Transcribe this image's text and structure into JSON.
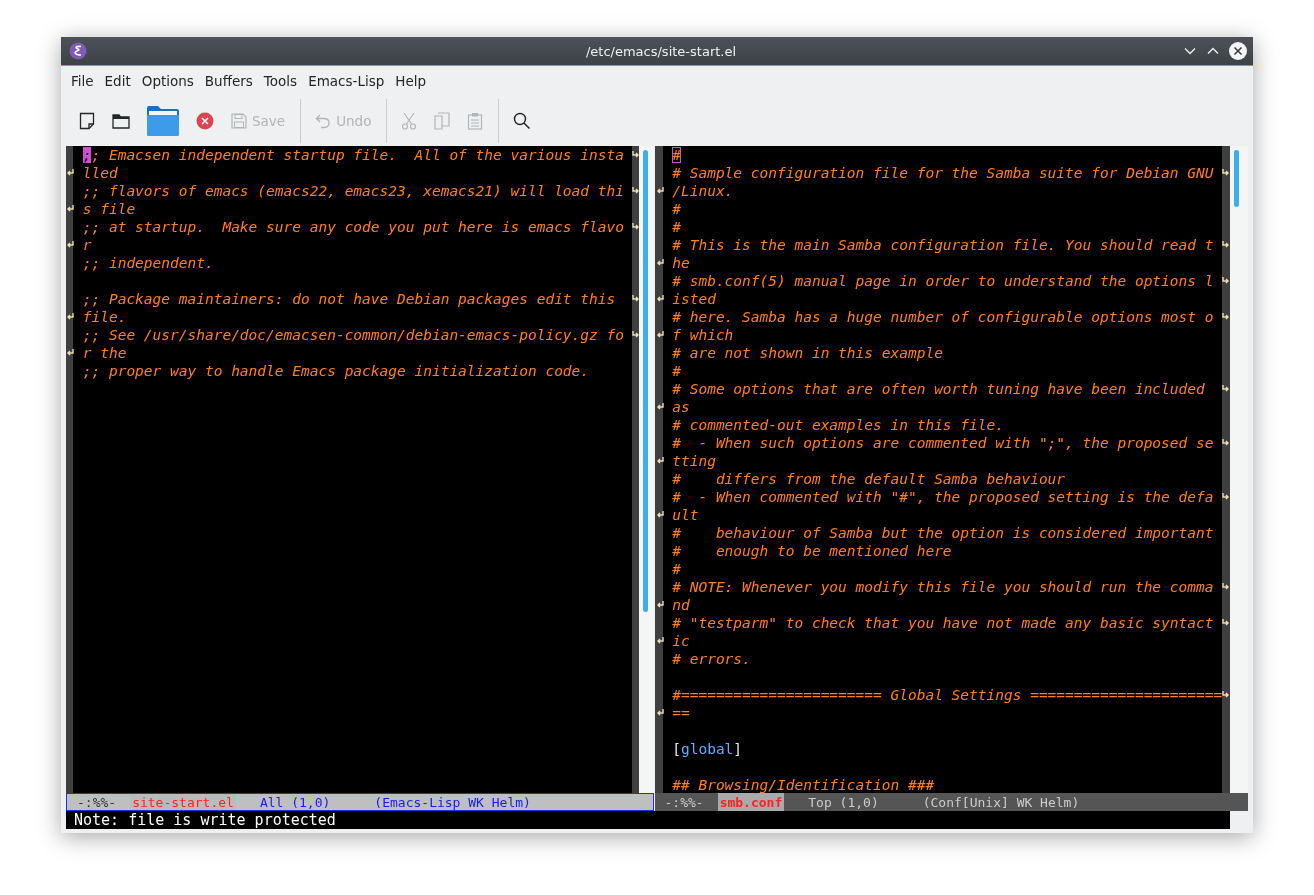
{
  "window": {
    "title": "/etc/emacs/site-start.el"
  },
  "menu": [
    "File",
    "Edit",
    "Options",
    "Buffers",
    "Tools",
    "Emacs-Lisp",
    "Help"
  ],
  "toolbar": [
    {
      "kind": "new-file",
      "disabled": false
    },
    {
      "kind": "open-file",
      "disabled": false
    },
    {
      "kind": "open-directory",
      "disabled": false
    },
    {
      "kind": "close",
      "disabled": false
    },
    {
      "kind": "save",
      "label": "Save",
      "disabled": true
    },
    {
      "kind": "separator"
    },
    {
      "kind": "undo",
      "label": "Undo",
      "disabled": true
    },
    {
      "kind": "separator"
    },
    {
      "kind": "cut",
      "disabled": true
    },
    {
      "kind": "copy",
      "disabled": true
    },
    {
      "kind": "paste",
      "disabled": true
    },
    {
      "kind": "separator"
    },
    {
      "kind": "search",
      "disabled": false
    }
  ],
  "panes": [
    {
      "active": true,
      "lines": [
        {
          "kind": "comment",
          "segments": [
            ";; Emacsen independent startup file.  All of the various insta",
            "lled"
          ]
        },
        {
          "kind": "comment",
          "segments": [
            ";; flavors of emacs (emacs22, emacs23, xemacs21) will load thi",
            "s file"
          ]
        },
        {
          "kind": "comment",
          "segments": [
            ";; at startup.  Make sure any code you put here is emacs flavo",
            "r"
          ]
        },
        {
          "kind": "comment",
          "segments": [
            ";; independent."
          ]
        },
        {
          "kind": "blank"
        },
        {
          "kind": "comment",
          "segments": [
            ";; Package maintainers: do not have Debian packages edit this ",
            "file."
          ]
        },
        {
          "kind": "comment",
          "segments": [
            ";; See /usr/share/doc/emacsen-common/debian-emacs-policy.gz fo",
            "r the"
          ]
        },
        {
          "kind": "comment",
          "segments": [
            ";; proper way to handle Emacs package initialization code."
          ]
        }
      ],
      "mode_line": {
        "status": "-:%%-",
        "buffer": "site-start.el",
        "position": "All (1,0)",
        "modes": "(Emacs-Lisp WK Helm)"
      }
    },
    {
      "active": false,
      "lines": [
        {
          "kind": "comment",
          "segments": [
            "#"
          ]
        },
        {
          "kind": "comment",
          "segments": [
            "# Sample configuration file for the Samba suite for Debian GNU",
            "/Linux."
          ]
        },
        {
          "kind": "comment",
          "segments": [
            "#"
          ]
        },
        {
          "kind": "comment",
          "segments": [
            "#"
          ]
        },
        {
          "kind": "comment",
          "segments": [
            "# This is the main Samba configuration file. You should read t",
            "he"
          ]
        },
        {
          "kind": "comment",
          "segments": [
            "# smb.conf(5) manual page in order to understand the options l",
            "isted"
          ]
        },
        {
          "kind": "comment",
          "segments": [
            "# here. Samba has a huge number of configurable options most o",
            "f which"
          ]
        },
        {
          "kind": "comment",
          "segments": [
            "# are not shown in this example"
          ]
        },
        {
          "kind": "comment",
          "segments": [
            "#"
          ]
        },
        {
          "kind": "comment",
          "segments": [
            "# Some options that are often worth tuning have been included ",
            "as"
          ]
        },
        {
          "kind": "comment",
          "segments": [
            "# commented-out examples in this file."
          ]
        },
        {
          "kind": "comment",
          "segments": [
            "#  - When such options are commented with \";\", the proposed se",
            "tting"
          ]
        },
        {
          "kind": "comment",
          "segments": [
            "#    differs from the default Samba behaviour"
          ]
        },
        {
          "kind": "comment",
          "segments": [
            "#  - When commented with \"#\", the proposed setting is the defa",
            "ult"
          ]
        },
        {
          "kind": "comment",
          "segments": [
            "#    behaviour of Samba but the option is considered important"
          ]
        },
        {
          "kind": "comment",
          "segments": [
            "#    enough to be mentioned here"
          ]
        },
        {
          "kind": "comment",
          "segments": [
            "#"
          ]
        },
        {
          "kind": "comment",
          "segments": [
            "# NOTE: Whenever you modify this file you should run the comma",
            "nd"
          ]
        },
        {
          "kind": "comment",
          "segments": [
            "# \"testparm\" to check that you have not made any basic syntact",
            "ic"
          ]
        },
        {
          "kind": "comment",
          "segments": [
            "# errors."
          ]
        },
        {
          "kind": "blank"
        },
        {
          "kind": "comment",
          "segments": [
            "#======================= Global Settings ======================",
            "=="
          ]
        },
        {
          "kind": "blank"
        },
        {
          "kind": "section",
          "parts": [
            "[",
            "global",
            "]"
          ]
        },
        {
          "kind": "blank"
        },
        {
          "kind": "comment",
          "segments": [
            "## Browsing/Identification ###"
          ]
        }
      ],
      "mode_line": {
        "status": "-:%%-",
        "buffer": "smb.conf",
        "position": "Top (1,0)",
        "modes": "(Conf[Unix] WK Helm)"
      }
    }
  ],
  "minibuffer": "Note: file is write protected"
}
